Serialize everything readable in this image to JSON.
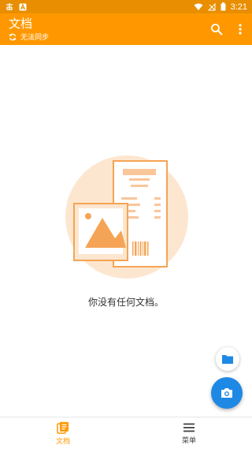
{
  "status_bar": {
    "time": "3:21",
    "icons": [
      "chinese-char-icon",
      "a-badge-icon",
      "wifi-icon",
      "no-signal-icon",
      "battery-icon"
    ]
  },
  "app_bar": {
    "title": "文档",
    "sync_status": "无法同步",
    "actions": [
      "search-icon",
      "more-vert-icon"
    ]
  },
  "empty_state": {
    "message": "你没有任何文档。"
  },
  "fabs": {
    "small": "folder-icon",
    "large": "camera-icon"
  },
  "bottom_nav": {
    "items": [
      {
        "label": "文档",
        "icon": "documents-icon",
        "active": true
      },
      {
        "label": "菜单",
        "icon": "menu-icon",
        "active": false
      }
    ]
  },
  "colors": {
    "accent": "#FF9800",
    "status_bar": "#E88E00",
    "fab_blue": "#1E88E5",
    "illustration_bg": "#FDE6CF"
  }
}
